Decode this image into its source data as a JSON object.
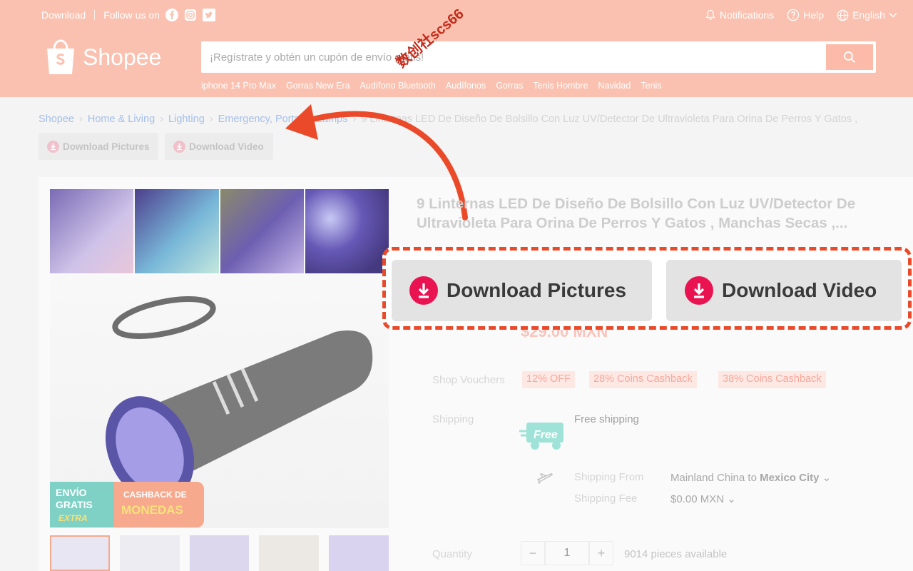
{
  "topbar": {
    "download": "Download",
    "follow": "Follow us on",
    "notifications": "Notifications",
    "help": "Help",
    "language": "English"
  },
  "header": {
    "logo_text": "Shopee",
    "search_placeholder": "¡Regístrate y obtén un cupón de envío gratis!",
    "search_hints": [
      "iphone 14 Pro Max",
      "Gorras New Era",
      "Audífono Bluetooth",
      "Audífonos",
      "Gorras",
      "Tenis Hombre",
      "Navidad",
      "Tenis"
    ]
  },
  "breadcrumb": {
    "items": [
      "Shopee",
      "Home & Living",
      "Lighting",
      "Emergency, Portable Lamps"
    ],
    "current": "9 Linternas LED De Diseño De Bolsillo Con Luz UV/Detector De Ultravioleta Para Orina De Perros Y Gatos ,"
  },
  "mini_buttons": {
    "pictures": "Download Pictures",
    "video": "Download Video"
  },
  "product": {
    "title": "9 Linternas LED De Diseño De Bolsillo Con Luz UV/Detector De Ultravioleta Para Orina De Perros Y Gatos , Manchas Secas ,...",
    "price": "$29.00 MXN"
  },
  "big_buttons": {
    "pictures": "Download Pictures",
    "video": "Download Video"
  },
  "vouchers": {
    "label": "Shop Vouchers",
    "tags": [
      "12% OFF",
      "28% Coins Cashback",
      "38% Coins Cashback"
    ]
  },
  "shipping": {
    "label": "Shipping",
    "free": "Free shipping",
    "truck_label": "Free",
    "from_label": "Shipping From",
    "from_value": "Mainland China to",
    "to_city": "Mexico City",
    "fee_label": "Shipping Fee",
    "fee_value": "$0.00 MXN"
  },
  "quantity": {
    "label": "Quantity",
    "value": "1",
    "available": "9014 pieces available",
    "minus": "−",
    "plus": "+"
  },
  "badge": {
    "line1": "ENVÍO",
    "line2": "GRATIS",
    "line3": "EXTRA",
    "line4": "CASHBACK DE",
    "line5": "MONEDAS"
  },
  "watermark": "数创社scs66",
  "colors": {
    "accent": "#ea4a2a",
    "download_icon": "#ea1352",
    "header_bg": "#fac1b0"
  }
}
